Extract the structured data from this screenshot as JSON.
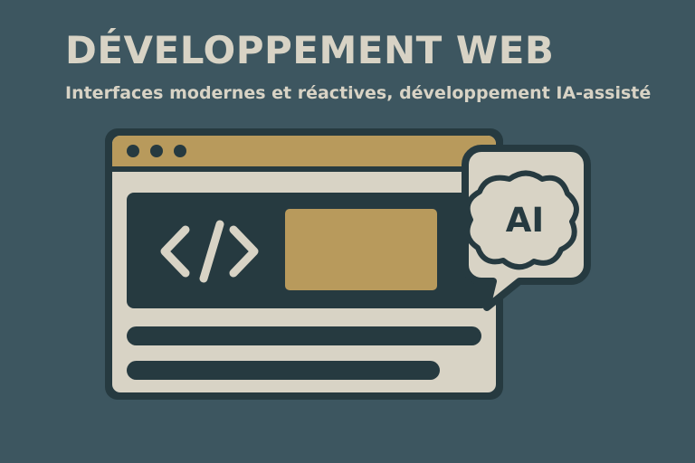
{
  "header": {
    "title": "DÉVELOPPEMENT WEB",
    "subtitle": "Interfaces modernes et réactives, développement IA-assisté"
  },
  "illustration": {
    "ai_label": "AI",
    "icons": [
      "browser-window-icon",
      "code-brackets-icon",
      "ai-brain-icon",
      "speech-bubble-icon"
    ]
  },
  "colors": {
    "background": "#3d5660",
    "text": "#d8d3c5",
    "dark": "#263a40",
    "accent": "#b89a5c",
    "window": "#d8d3c5"
  }
}
